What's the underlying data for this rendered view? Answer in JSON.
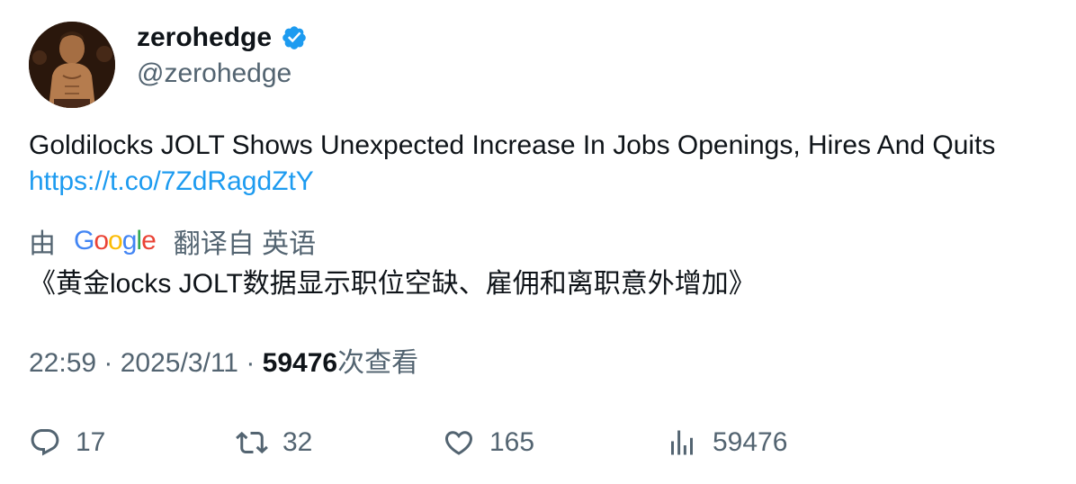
{
  "author": {
    "display_name": "zerohedge",
    "handle": "@zerohedge",
    "verified": true,
    "verified_color": "#1d9bf0"
  },
  "tweet": {
    "text": "Goldilocks JOLT Shows Unexpected Increase In Jobs Openings, Hires And Quits ",
    "link": "https://t.co/7ZdRagdZtY"
  },
  "translation": {
    "prefix": "由",
    "provider": "Google",
    "suffix": "翻译自 英语",
    "text": "《黄金locks JOLT数据显示职位空缺、雇佣和离职意外增加》"
  },
  "meta": {
    "time": "22:59",
    "sep1": " · ",
    "date": "2025/3/11",
    "sep2": " · ",
    "views_count": "59476",
    "views_label": "次查看"
  },
  "actions": {
    "replies": "17",
    "retweets": "32",
    "likes": "165",
    "views": "59476"
  },
  "colors": {
    "text": "#0f1419",
    "secondary": "#536471",
    "link": "#1d9bf0"
  }
}
